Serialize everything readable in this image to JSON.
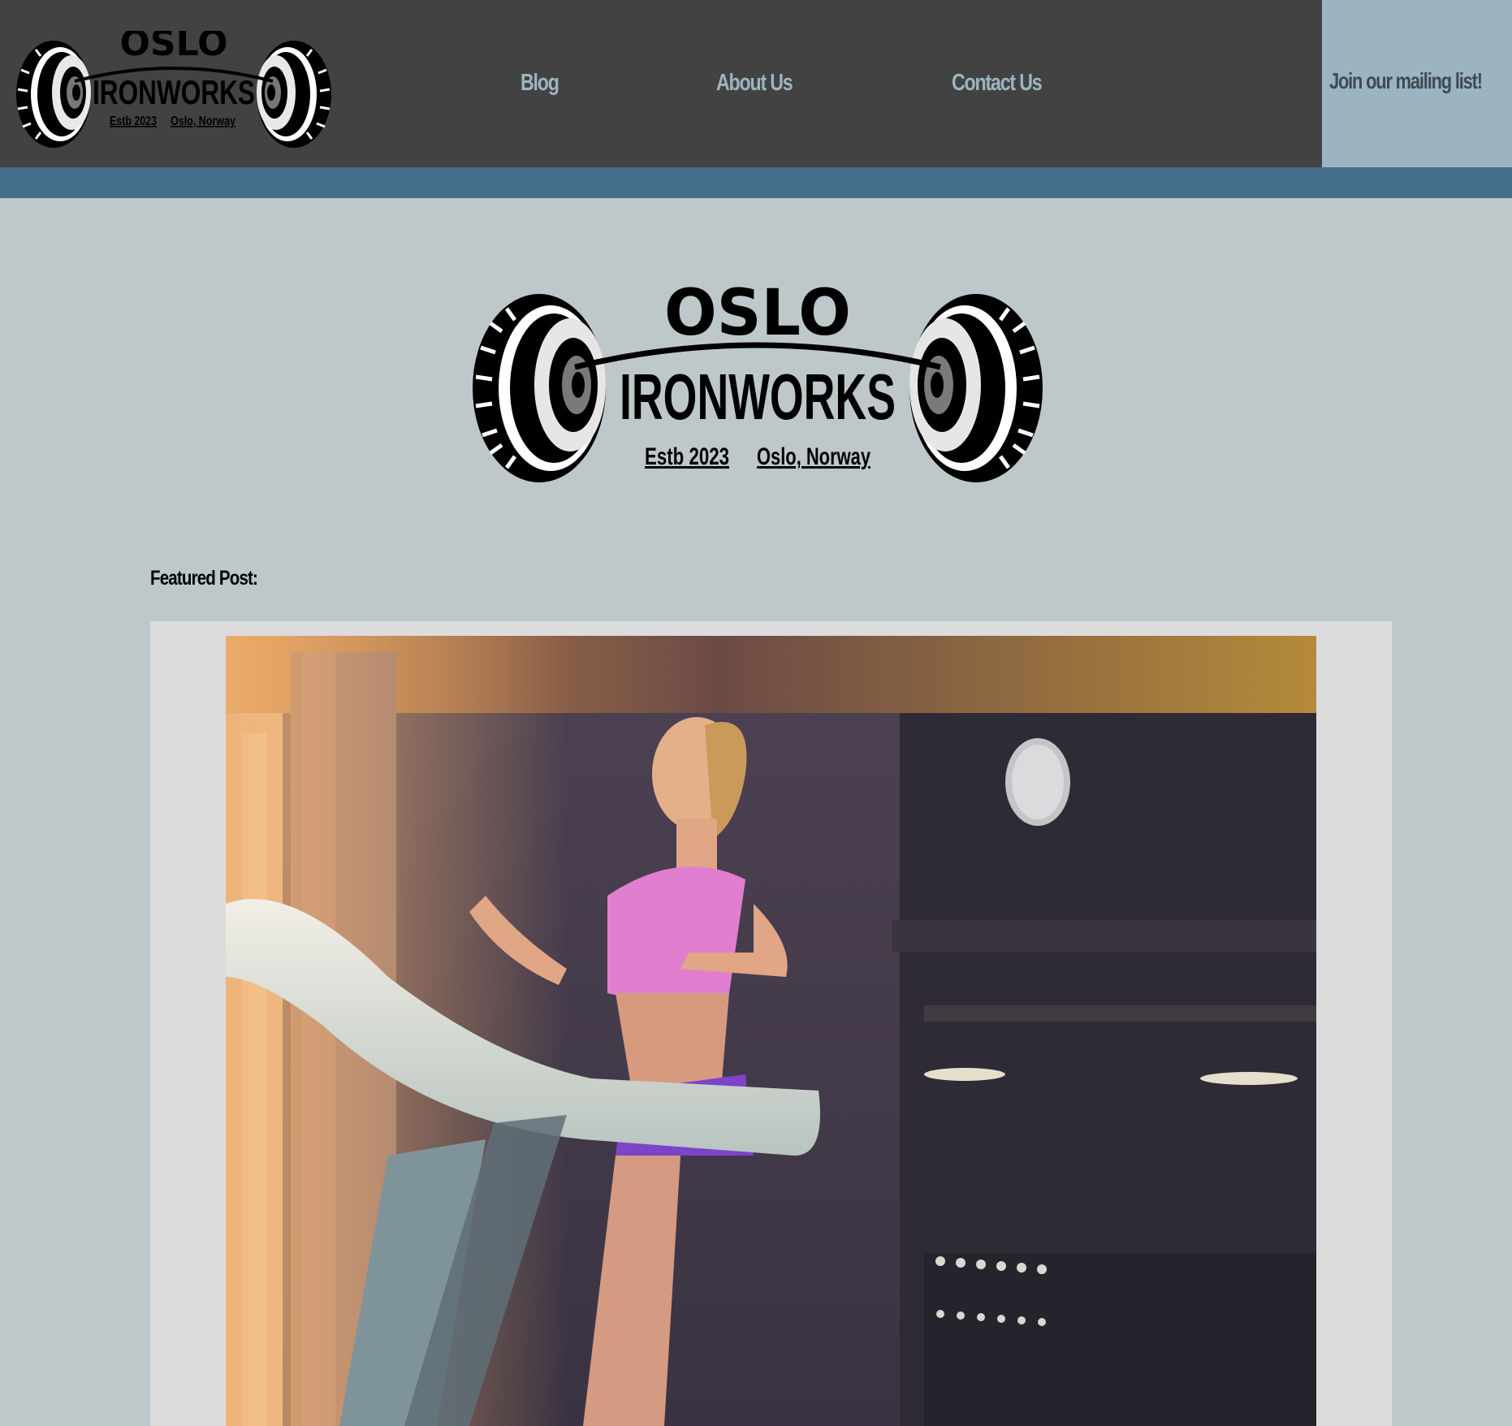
{
  "brand": {
    "name_top": "OSLO",
    "name_main": "IRONWORKS",
    "established": "Estb 2023",
    "location": "Oslo, Norway"
  },
  "nav": {
    "items": [
      {
        "label": "Blog"
      },
      {
        "label": "About Us"
      },
      {
        "label": "Contact Us"
      }
    ],
    "cta_label": "Join our mailing list!"
  },
  "featured": {
    "heading": "Featured Post:"
  },
  "colors": {
    "header_bg": "#424242",
    "nav_text": "#9db4c0",
    "cta_bg": "#9bb4c0",
    "accent_bar": "#446e8b",
    "page_bg": "#bec8ca",
    "card_bg": "#dcdcdc"
  }
}
